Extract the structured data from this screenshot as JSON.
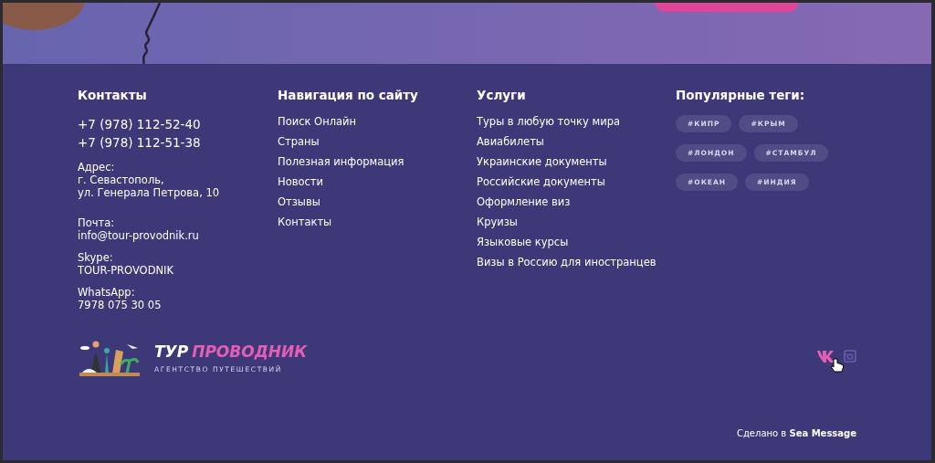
{
  "contacts": {
    "heading": "Контакты",
    "phones": [
      "+7 (978) 112-52-40",
      "+7 (978) 112-51-38"
    ],
    "details": [
      {
        "label": "Адрес:",
        "lines": [
          "г. Севастополь,",
          "ул. Генерала Петрова, 10"
        ]
      },
      {
        "label": "Почта:",
        "lines": [
          "info@tour-provodnik.ru"
        ]
      },
      {
        "label": "Skype:",
        "lines": [
          "TOUR-PROVODNIK"
        ]
      },
      {
        "label": "WhatsApp:",
        "lines": [
          "7978 075 30 05"
        ]
      }
    ]
  },
  "navigation": {
    "heading": "Навигация по сайту",
    "items": [
      "Поиск Онлайн",
      "Страны",
      "Полезная информация",
      "Новости",
      "Отзывы",
      "Контакты"
    ]
  },
  "services": {
    "heading": "Услуги",
    "items": [
      "Туры в любую точку мира",
      "Авиабилеты",
      "Украинские документы",
      "Российские документы",
      "Оформление виз",
      "Круизы",
      "Языковые курсы",
      "Визы в Россию для иностранцев"
    ]
  },
  "tags": {
    "heading": "Популярные теги:",
    "items": [
      "#КИПР",
      "#КРЫМ",
      "#ЛОНДОН",
      "#СТАМБУЛ",
      "#ОКЕАН",
      "#ИНДИЯ"
    ]
  },
  "logo": {
    "title_parts": [
      {
        "text": "ТУР",
        "color": "#ffffff"
      },
      {
        "text": "ПРОВОДНИК",
        "color": "#e35fb4"
      }
    ],
    "tagline": "АГЕНТСТВО ПУТЕШЕСТВИЙ"
  },
  "social": [
    {
      "kind": "vk",
      "hovered": true
    },
    {
      "kind": "instagram",
      "hovered": false
    }
  ],
  "credit": "Сделано в **Sea Message**"
}
